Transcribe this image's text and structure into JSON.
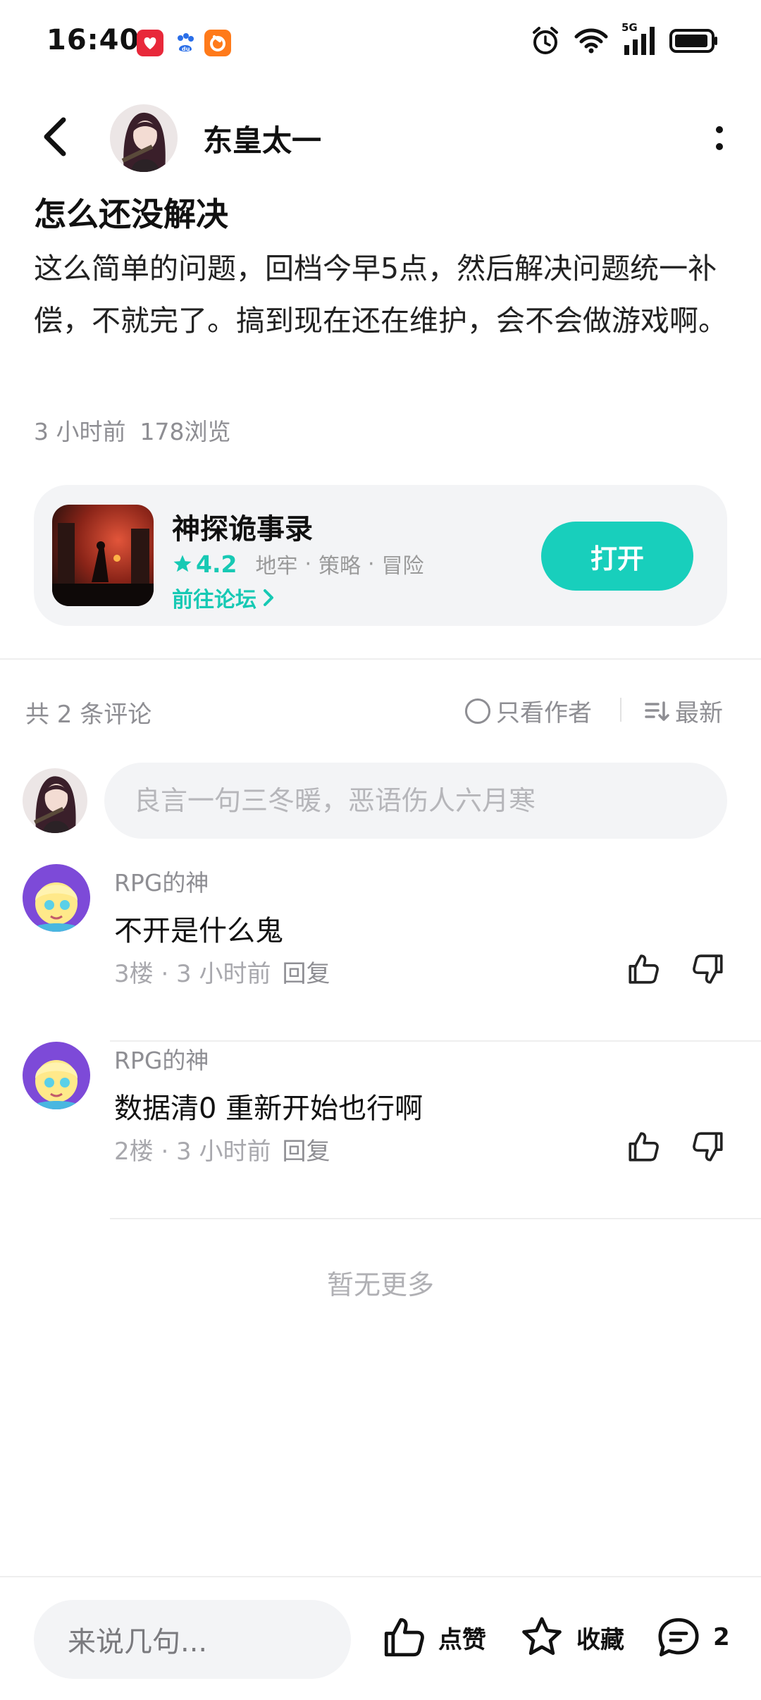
{
  "status_bar": {
    "time": "16:40",
    "network": "5G",
    "icons": [
      "app-notification-red-icon",
      "baidu-icon",
      "app-notification-orange-icon",
      "alarm-icon",
      "wifi-icon",
      "signal-icon",
      "battery-icon"
    ]
  },
  "header": {
    "author_name": "东皇太一"
  },
  "post": {
    "title": "怎么还没解决",
    "body": "这么简单的问题，回档今早5点，然后解决问题统一补偿，不就完了。搞到现在还在维护，会不会做游戏啊。",
    "time": "3 小时前",
    "views": "178浏览"
  },
  "game_card": {
    "name": "神探诡事录",
    "rating": "4.2",
    "tags": [
      "地牢",
      "策略",
      "冒险"
    ],
    "forum_link": "前往论坛",
    "open_label": "打开"
  },
  "comments_header": {
    "count": "共 2 条评论",
    "only_author": "只看作者",
    "sort": "最新"
  },
  "comment_input": {
    "placeholder": "良言一句三冬暖，恶语伤人六月寒"
  },
  "comments": [
    {
      "user": "RPG的神",
      "text": "不开是什么鬼",
      "meta": "3楼 · 3 小时前",
      "reply": "回复"
    },
    {
      "user": "RPG的神",
      "text": "数据清0 重新开始也行啊",
      "meta": "2楼 · 3 小时前",
      "reply": "回复"
    }
  ],
  "no_more": "暂无更多",
  "bottom_bar": {
    "input_placeholder": "来说几句...",
    "like_label": "点赞",
    "fav_label": "收藏",
    "comment_count": "2"
  },
  "colors": {
    "accent": "#18cfbc",
    "accent_text": "#17c9b4",
    "muted": "#8e8e93",
    "card_bg": "#f3f4f6"
  }
}
